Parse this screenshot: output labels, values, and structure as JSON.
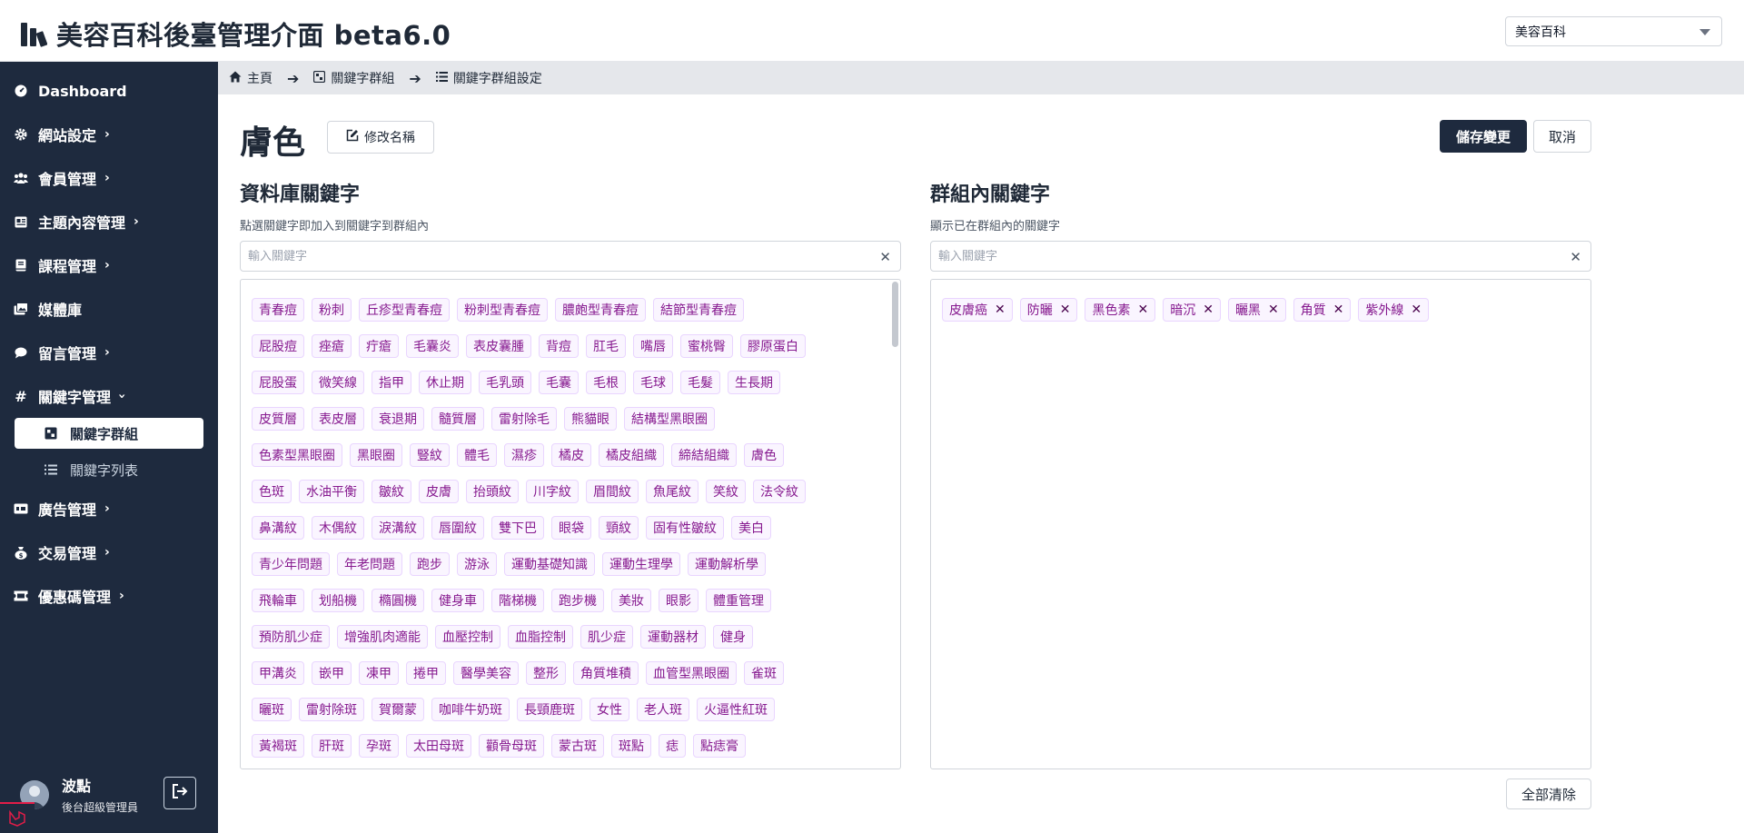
{
  "app": {
    "title": "美容百科後臺管理介面 beta6.0",
    "site_select": "美容百科"
  },
  "sidebar": {
    "items": [
      {
        "label": "Dashboard",
        "icon": "dashboard-icon"
      },
      {
        "label": "網站設定",
        "icon": "gear-icon"
      },
      {
        "label": "會員管理",
        "icon": "users-icon"
      },
      {
        "label": "主題內容管理",
        "icon": "newspaper-icon"
      },
      {
        "label": "課程管理",
        "icon": "book-icon"
      },
      {
        "label": "媒體庫",
        "icon": "images-icon"
      },
      {
        "label": "留言管理",
        "icon": "comment-icon"
      },
      {
        "label": "關鍵字管理",
        "icon": "hashtag-icon"
      },
      {
        "label": "廣告管理",
        "icon": "ad-icon"
      },
      {
        "label": "交易管理",
        "icon": "money-bag-icon"
      },
      {
        "label": "優惠碼管理",
        "icon": "ticket-icon"
      }
    ],
    "sub_items": [
      {
        "label": "關鍵字群組"
      },
      {
        "label": "關鍵字列表"
      }
    ],
    "user": {
      "name": "波點",
      "role": "後台超級管理員"
    }
  },
  "breadcrumb": [
    {
      "label": "主頁"
    },
    {
      "label": "關鍵字群組"
    },
    {
      "label": "關鍵字群組設定"
    }
  ],
  "page": {
    "title": "膚色",
    "rename_label": "修改名稱",
    "save_label": "儲存變更",
    "cancel_label": "取消",
    "clear_all_label": "全部清除"
  },
  "left": {
    "title": "資料庫關鍵字",
    "desc": "點選關鍵字即加入到關鍵字到群組內",
    "placeholder": "輸入關鍵字",
    "rows": [
      [
        "青春痘",
        "粉刺",
        "丘疹型青春痘",
        "粉刺型青春痘",
        "膿皰型青春痘",
        "結節型青春痘"
      ],
      [
        "屁股痘",
        "痤瘡",
        "疔瘡",
        "毛囊炎",
        "表皮囊腫",
        "背痘",
        "肛毛",
        "嘴唇",
        "蜜桃臀",
        "膠原蛋白"
      ],
      [
        "屁股蛋",
        "微笑線",
        "指甲",
        "休止期",
        "毛乳頭",
        "毛囊",
        "毛根",
        "毛球",
        "毛髮",
        "生長期"
      ],
      [
        "皮質層",
        "表皮層",
        "衰退期",
        "髓質層",
        "雷射除毛",
        "熊貓眼",
        "結構型黑眼圈"
      ],
      [
        "色素型黑眼圈",
        "黑眼圈",
        "豎紋",
        "體毛",
        "濕疹",
        "橘皮",
        "橘皮組織",
        "締結組織",
        "膚色"
      ],
      [
        "色斑",
        "水油平衡",
        "皺紋",
        "皮膚",
        "抬頭紋",
        "川字紋",
        "眉間紋",
        "魚尾紋",
        "笑紋",
        "法令紋"
      ],
      [
        "鼻溝紋",
        "木偶紋",
        "淚溝紋",
        "唇圍紋",
        "雙下巴",
        "眼袋",
        "頸紋",
        "固有性皺紋",
        "美白"
      ],
      [
        "青少年問題",
        "年老問題",
        "跑步",
        "游泳",
        "運動基礎知識",
        "運動生理學",
        "運動解析學"
      ],
      [
        "飛輪車",
        "划船機",
        "橢圓機",
        "健身車",
        "階梯機",
        "跑步機",
        "美妝",
        "眼影",
        "體重管理"
      ],
      [
        "預防肌少症",
        "增強肌肉適能",
        "血壓控制",
        "血脂控制",
        "肌少症",
        "運動器材",
        "健身"
      ],
      [
        "甲溝炎",
        "嵌甲",
        "凍甲",
        "捲甲",
        "醫學美容",
        "整形",
        "角質堆積",
        "血管型黑眼圈",
        "雀斑"
      ],
      [
        "曬斑",
        "雷射除斑",
        "賀爾蒙",
        "咖啡牛奶斑",
        "長頸鹿斑",
        "女性",
        "老人斑",
        "火逼性紅斑"
      ],
      [
        "黃褐斑",
        "肝斑",
        "孕斑",
        "太田母斑",
        "顴骨母斑",
        "蒙古斑",
        "斑點",
        "痣",
        "點痣膏"
      ]
    ]
  },
  "right": {
    "title": "群組內關鍵字",
    "desc": "顯示已在群組內的關鍵字",
    "placeholder": "輸入關鍵字",
    "tags": [
      "皮膚癌",
      "防曬",
      "黑色素",
      "暗沉",
      "曬黑",
      "角質",
      "紫外線"
    ]
  }
}
